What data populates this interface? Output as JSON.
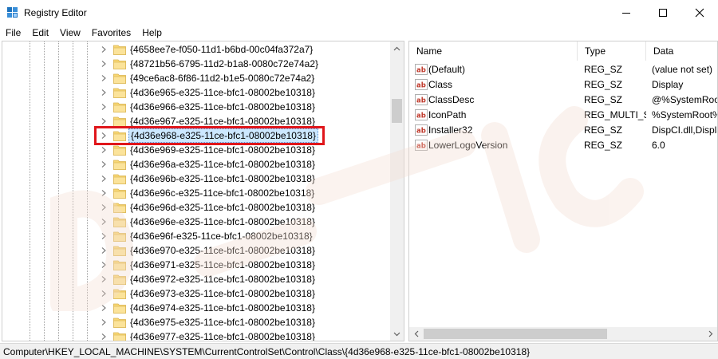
{
  "window": {
    "title": "Registry Editor",
    "minimize_glyph": "—",
    "maximize_glyph": "☐",
    "close_glyph": "✕"
  },
  "menu": [
    "File",
    "Edit",
    "View",
    "Favorites",
    "Help"
  ],
  "tree": {
    "selected_index": 6,
    "keys": [
      "{4658ee7e-f050-11d1-b6bd-00c04fa372a7}",
      "{48721b56-6795-11d2-b1a8-0080c72e74a2}",
      "{49ce6ac8-6f86-11d2-b1e5-0080c72e74a2}",
      "{4d36e965-e325-11ce-bfc1-08002be10318}",
      "{4d36e966-e325-11ce-bfc1-08002be10318}",
      "{4d36e967-e325-11ce-bfc1-08002be10318}",
      "{4d36e968-e325-11ce-bfc1-08002be10318}",
      "{4d36e969-e325-11ce-bfc1-08002be10318}",
      "{4d36e96a-e325-11ce-bfc1-08002be10318}",
      "{4d36e96b-e325-11ce-bfc1-08002be10318}",
      "{4d36e96c-e325-11ce-bfc1-08002be10318}",
      "{4d36e96d-e325-11ce-bfc1-08002be10318}",
      "{4d36e96e-e325-11ce-bfc1-08002be10318}",
      "{4d36e96f-e325-11ce-bfc1-08002be10318}",
      "{4d36e970-e325-11ce-bfc1-08002be10318}",
      "{4d36e971-e325-11ce-bfc1-08002be10318}",
      "{4d36e972-e325-11ce-bfc1-08002be10318}",
      "{4d36e973-e325-11ce-bfc1-08002be10318}",
      "{4d36e974-e325-11ce-bfc1-08002be10318}",
      "{4d36e975-e325-11ce-bfc1-08002be10318}",
      "{4d36e977-e325-11ce-bfc1-08002be10318}"
    ]
  },
  "values": {
    "columns": {
      "name": "Name",
      "type": "Type",
      "data": "Data"
    },
    "rows": [
      {
        "name": "(Default)",
        "type": "REG_SZ",
        "data": "(value not set)"
      },
      {
        "name": "Class",
        "type": "REG_SZ",
        "data": "Display"
      },
      {
        "name": "ClassDesc",
        "type": "REG_SZ",
        "data": "@%SystemRoot%"
      },
      {
        "name": "IconPath",
        "type": "REG_MULTI_SZ",
        "data": "%SystemRoot%"
      },
      {
        "name": "Installer32",
        "type": "REG_SZ",
        "data": "DispCI.dll,Display"
      },
      {
        "name": "LowerLogoVersion",
        "type": "REG_SZ",
        "data": "6.0"
      }
    ]
  },
  "status_path": "Computer\\HKEY_LOCAL_MACHINE\\SYSTEM\\CurrentControlSet\\Control\\Class\\{4d36e968-e325-11ce-bfc1-08002be10318}",
  "colors": {
    "selection": "#cce8ff",
    "highlight_box": "#e0161b",
    "folder": "#f8d775",
    "value_icon": "#c0392b",
    "watermark": "#f3dcd0"
  }
}
